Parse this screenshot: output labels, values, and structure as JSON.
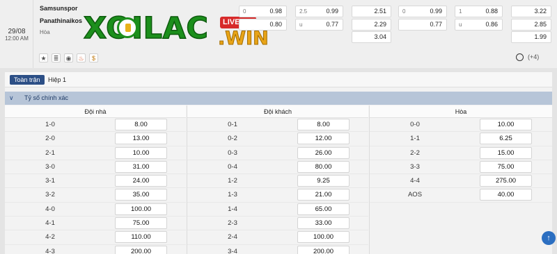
{
  "match": {
    "date": "29/08",
    "time": "12:00 AM",
    "home_team": "Samsunspor",
    "away_team": "Panathinaikos",
    "draw_label": "Hòa"
  },
  "logo": {
    "text": "XOILAC",
    "live": "LIVE",
    "win": ".WIN"
  },
  "odds": {
    "group1": {
      "hc1": "0",
      "v1": "0.98",
      "hc2": "",
      "v2": "0.80"
    },
    "group2": {
      "hc1": "2.5",
      "v1": "0.99",
      "hc2": "u",
      "v2": "0.77"
    },
    "group3": {
      "v1": "2.51",
      "v2": "2.29",
      "v3": "3.04"
    },
    "group4": {
      "hc1": "0",
      "v1": "0.99",
      "hc2": "",
      "v2": "0.77"
    },
    "group5": {
      "hc1": "1",
      "v1": "0.88",
      "hc2": "u",
      "v2": "0.86"
    },
    "group6": {
      "v1": "3.22",
      "v2": "2.85",
      "v3": "1.99"
    }
  },
  "more_markets": "(+4)",
  "tabs": {
    "full": "Toàn trận",
    "half": "Hiệp 1"
  },
  "section_title": "Tỷ số chính xác",
  "columns": [
    {
      "header": "Đội nhà",
      "rows": [
        {
          "score": "1-0",
          "odd": "8.00"
        },
        {
          "score": "2-0",
          "odd": "13.00"
        },
        {
          "score": "2-1",
          "odd": "10.00"
        },
        {
          "score": "3-0",
          "odd": "31.00"
        },
        {
          "score": "3-1",
          "odd": "24.00"
        },
        {
          "score": "3-2",
          "odd": "35.00"
        },
        {
          "score": "4-0",
          "odd": "100.00"
        },
        {
          "score": "4-1",
          "odd": "75.00"
        },
        {
          "score": "4-2",
          "odd": "110.00"
        },
        {
          "score": "4-3",
          "odd": "200.00"
        }
      ]
    },
    {
      "header": "Đội khách",
      "rows": [
        {
          "score": "0-1",
          "odd": "8.00"
        },
        {
          "score": "0-2",
          "odd": "12.00"
        },
        {
          "score": "0-3",
          "odd": "26.00"
        },
        {
          "score": "0-4",
          "odd": "80.00"
        },
        {
          "score": "1-2",
          "odd": "9.25"
        },
        {
          "score": "1-3",
          "odd": "21.00"
        },
        {
          "score": "1-4",
          "odd": "65.00"
        },
        {
          "score": "2-3",
          "odd": "33.00"
        },
        {
          "score": "2-4",
          "odd": "100.00"
        },
        {
          "score": "3-4",
          "odd": "200.00"
        }
      ]
    },
    {
      "header": "Hòa",
      "rows": [
        {
          "score": "0-0",
          "odd": "10.00"
        },
        {
          "score": "1-1",
          "odd": "6.25"
        },
        {
          "score": "2-2",
          "odd": "15.00"
        },
        {
          "score": "3-3",
          "odd": "75.00"
        },
        {
          "score": "4-4",
          "odd": "275.00"
        },
        {
          "score": "AOS",
          "odd": "40.00"
        }
      ]
    }
  ]
}
